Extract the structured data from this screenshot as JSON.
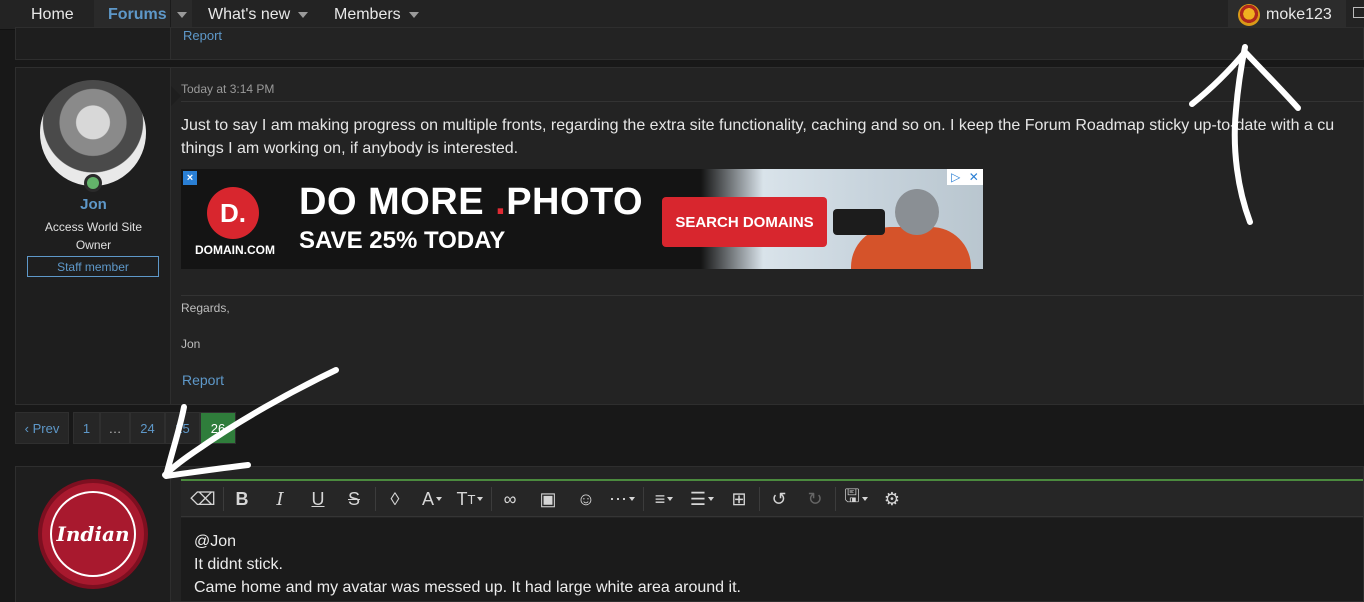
{
  "nav": {
    "home": "Home",
    "forums": "Forums",
    "whats_new": "What's new",
    "members": "Members",
    "username": "moke123"
  },
  "previous_post": {
    "report": "Report"
  },
  "post": {
    "author": "Jon",
    "title": "Access World Site Owner",
    "badge": "Staff member",
    "date": "Today at 3:14 PM",
    "body_line1": "Just to say I am making progress on multiple fronts, regarding the extra site functionality, caching and so on. I keep the Forum Roadmap sticky up-to-date with a cu",
    "body_line2": "things I am working on, if anybody is interested.",
    "signature": [
      "Regards,",
      "Jon"
    ],
    "report": "Report"
  },
  "ad": {
    "headline_a": "DO MORE ",
    "headline_dot": ".",
    "headline_b": "PHOTO",
    "sub": "SAVE 25% TODAY",
    "button": "SEARCH DOMAINS",
    "logo_text": "DOMAIN.COM",
    "logo_letter": "D."
  },
  "pagination": {
    "prev": "Prev",
    "pages": [
      "1",
      "…",
      "24",
      "25",
      "26"
    ],
    "current": "26"
  },
  "reply": {
    "avatar_text": "Indian",
    "lines": [
      "@Jon",
      "It didnt stick.",
      "Came home and my avatar was messed up. It had large white area around it."
    ]
  },
  "colors": {
    "accent": "#5e98c9",
    "current_page": "#2f7d3b",
    "ad_red": "#d8262e"
  }
}
